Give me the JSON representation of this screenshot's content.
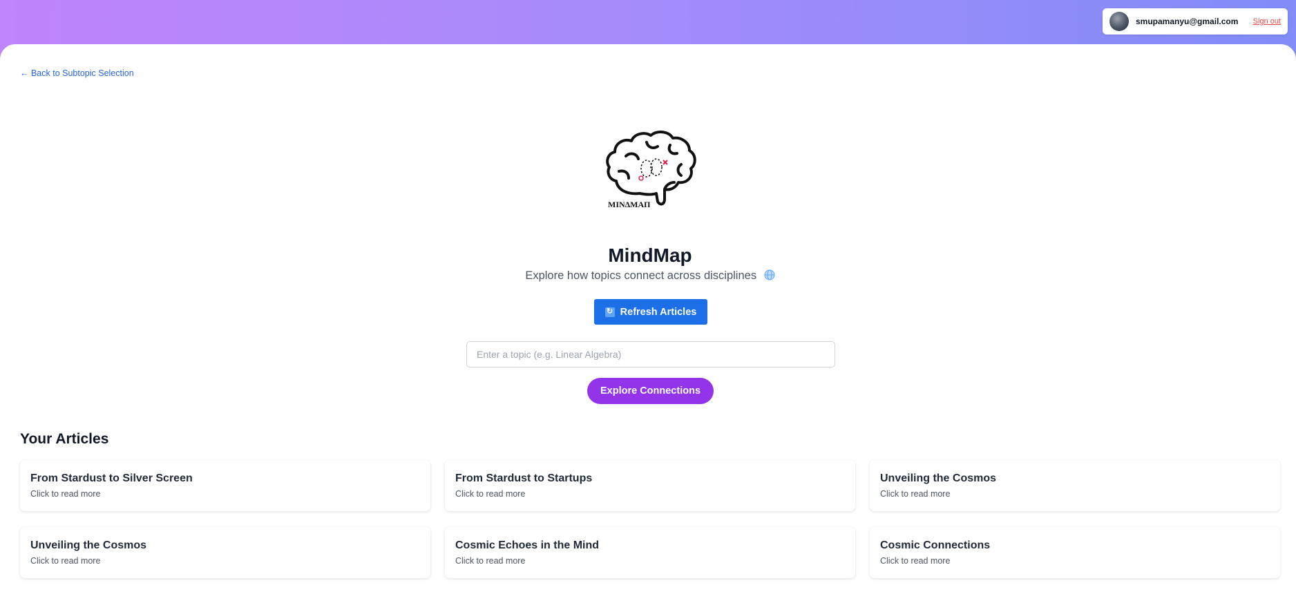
{
  "user": {
    "email": "smupamanyu@gmail.com",
    "signout_label": "Sign out"
  },
  "nav": {
    "back_label": "← Back to Subtopic Selection"
  },
  "logo": {
    "text": "MINΔMAΠ",
    "icon": "brain-icon"
  },
  "hero": {
    "title": "MindMap",
    "subtitle": "Explore how topics connect across disciplines",
    "subtitle_icon": "globe-icon"
  },
  "actions": {
    "refresh_label": "Refresh Articles",
    "refresh_icon": "refresh-icon",
    "topic_placeholder": "Enter a topic (e.g. Linear Algebra)",
    "topic_value": "",
    "explore_label": "Explore Connections"
  },
  "articles": {
    "heading": "Your Articles",
    "items": [
      {
        "title": "From Stardust to Silver Screen",
        "subtitle": "Click to read more"
      },
      {
        "title": "From Stardust to Startups",
        "subtitle": "Click to read more"
      },
      {
        "title": "Unveiling the Cosmos",
        "subtitle": "Click to read more"
      },
      {
        "title": "Unveiling the Cosmos",
        "subtitle": "Click to read more"
      },
      {
        "title": "Cosmic Echoes in the Mind",
        "subtitle": "Click to read more"
      },
      {
        "title": "Cosmic Connections",
        "subtitle": "Click to read more"
      }
    ]
  },
  "colors": {
    "gradient_start": "#c084fc",
    "gradient_end": "#818cf8",
    "primary_blue": "#1d6fe8",
    "primary_purple": "#9333ea",
    "signout_red": "#ef4444",
    "link_blue": "#2563eb"
  }
}
